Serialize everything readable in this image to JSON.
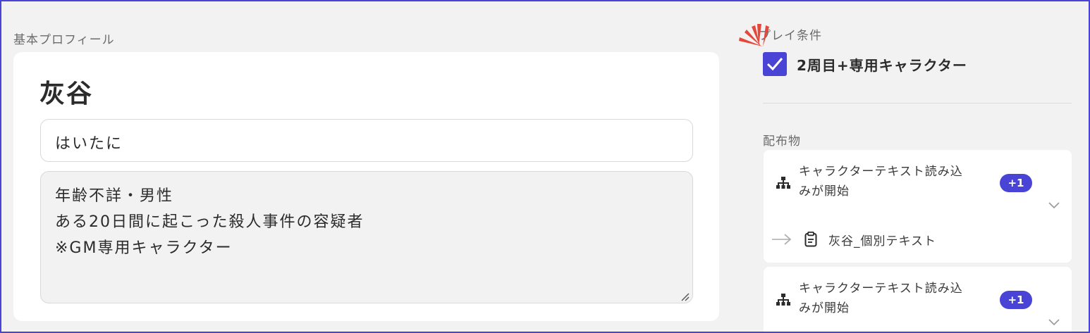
{
  "profile": {
    "section_label": "基本プロフィール",
    "name": "灰谷",
    "reading": "はいたに",
    "description_lines": [
      "年齢不詳・男性",
      "ある20日間に起こった殺人事件の容疑者",
      "※GM専用キャラクター"
    ]
  },
  "play_condition": {
    "label": "プレイ条件",
    "checked": true,
    "option_label": "2周目+専用キャラクター"
  },
  "distribution": {
    "label": "配布物",
    "items": [
      {
        "trigger_line1": "キャラクターテキスト読み込",
        "trigger_line2": "みが開始",
        "badge": "+1",
        "action_label": "灰谷_個別テキスト"
      },
      {
        "trigger_line1": "キャラクターテキスト読み込",
        "trigger_line2": "みが開始",
        "badge": "+1"
      }
    ]
  },
  "colors": {
    "accent": "#4a44d6",
    "burst": "#e4483a",
    "background": "#f2f2f2",
    "card": "#ffffff"
  },
  "icons": [
    "tree-icon",
    "arrow-right-icon",
    "clipboard-icon",
    "chevron-down-icon",
    "check-icon",
    "burst-icon",
    "resize-grip-icon"
  ]
}
